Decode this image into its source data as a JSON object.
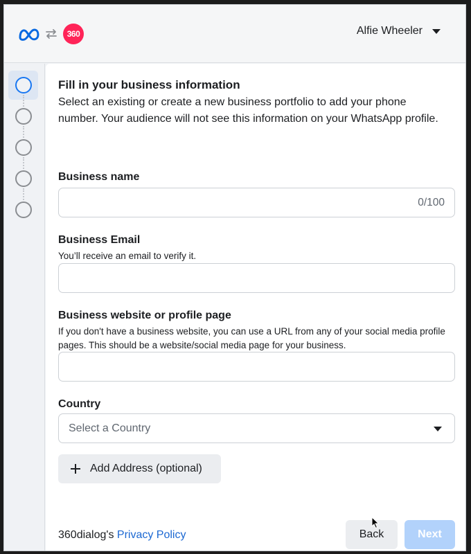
{
  "header": {
    "logos": [
      "meta-logo",
      "swap-icon",
      "360dialog-logo"
    ],
    "logo_360_text": "360",
    "user_name": "Alfie Wheeler"
  },
  "stepper": {
    "steps": 5,
    "active_step": 1
  },
  "form": {
    "title": "Fill in your business information",
    "description": "Select an existing or create a new business portfolio to add your phone number. Your audience will not see this information on your WhatsApp profile.",
    "business_name": {
      "label": "Business name",
      "value": "",
      "counter": "0/100"
    },
    "business_email": {
      "label": "Business Email",
      "hint": "You’ll receive an email to verify it.",
      "value": ""
    },
    "business_website": {
      "label": "Business website or profile page",
      "hint": "If you don't have a business website, you can use a URL from any of your social media profile pages. This should be a website/social media page for your business.",
      "value": ""
    },
    "country": {
      "label": "Country",
      "placeholder": "Select a Country"
    },
    "add_address_label": "Add Address (optional)"
  },
  "footer": {
    "policy_prefix": "360dialog's",
    "policy_link": "Privacy Policy",
    "back_label": "Back",
    "next_label": "Next"
  },
  "colors": {
    "accent": "#1877f2",
    "link": "#1a67d2",
    "next_disabled": "#b2d2fb",
    "logo_360": "#ff2458"
  }
}
